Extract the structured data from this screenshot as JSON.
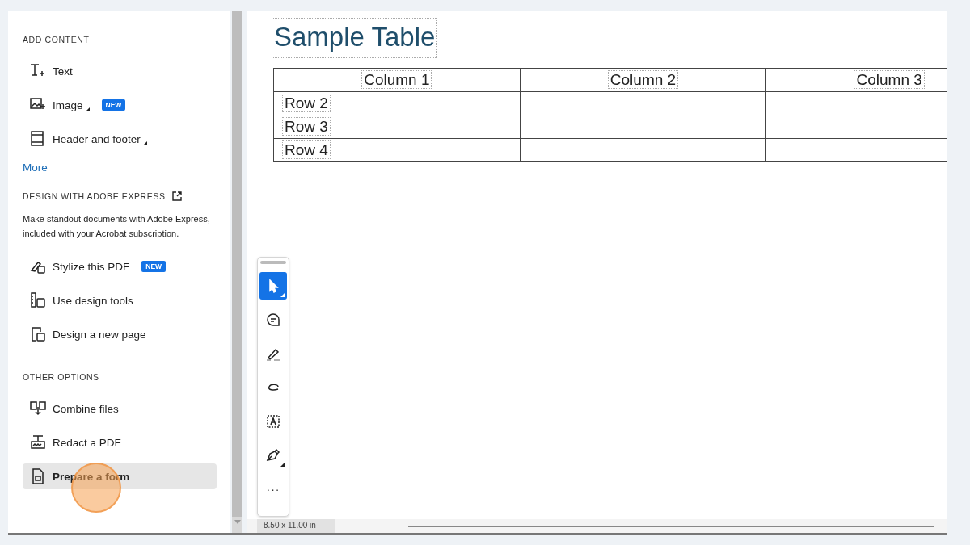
{
  "sidebar": {
    "sections": [
      {
        "title": "ADD CONTENT",
        "external": false,
        "items": [
          {
            "label": "Text",
            "dropdown": false,
            "selected": false
          },
          {
            "label": "Image",
            "dropdown": true,
            "badge": "NEW",
            "selected": false
          },
          {
            "label": "Header and footer",
            "dropdown": true,
            "selected": false
          }
        ],
        "more": "More"
      },
      {
        "title": "DESIGN WITH ADOBE EXPRESS",
        "external": true,
        "description": "Make standout documents with Adobe Express, included with your Acrobat subscription.",
        "items": [
          {
            "label": "Stylize this PDF",
            "dropdown": false,
            "badge": "NEW",
            "selected": false
          },
          {
            "label": "Use design tools",
            "dropdown": false,
            "selected": false
          },
          {
            "label": "Design a new page",
            "dropdown": false,
            "selected": false
          }
        ]
      },
      {
        "title": "OTHER OPTIONS",
        "external": false,
        "items": [
          {
            "label": "Combine files",
            "dropdown": false,
            "selected": false
          },
          {
            "label": "Redact a PDF",
            "dropdown": false,
            "selected": false
          },
          {
            "label": "Prepare a form",
            "dropdown": false,
            "selected": true
          }
        ]
      }
    ]
  },
  "document": {
    "title": "Sample Table",
    "table": {
      "columns": [
        "Column 1",
        "Column 2",
        "Column 3"
      ],
      "rows": [
        [
          "Row 2",
          "",
          ""
        ],
        [
          "Row 3",
          "",
          ""
        ],
        [
          "Row 4",
          "",
          ""
        ]
      ]
    }
  },
  "toolbar": [
    {
      "kind": "select",
      "selected": true,
      "dropdown": true
    },
    {
      "kind": "comment",
      "selected": false,
      "dropdown": false
    },
    {
      "kind": "highlight",
      "selected": false,
      "dropdown": false
    },
    {
      "kind": "draw",
      "selected": false,
      "dropdown": false
    },
    {
      "kind": "textbox",
      "selected": false,
      "dropdown": false
    },
    {
      "kind": "sign",
      "selected": false,
      "dropdown": true
    },
    {
      "kind": "more",
      "label": "···",
      "selected": false,
      "dropdown": false
    }
  ],
  "status_bar": {
    "page_size": "8.50 x 11.00 in"
  }
}
